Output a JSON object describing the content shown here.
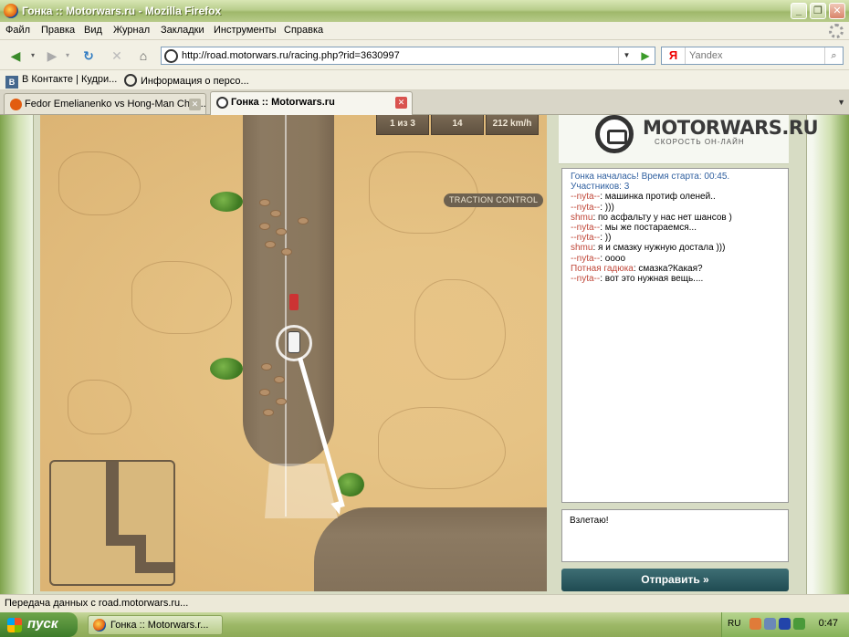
{
  "window": {
    "title": "Гонка :: Motorwars.ru - Mozilla Firefox"
  },
  "menu": [
    "Файл",
    "Правка",
    "Вид",
    "Журнал",
    "Закладки",
    "Инструменты",
    "Справка"
  ],
  "nav": {
    "url": "http://road.motorwars.ru/racing.php?rid=3630997",
    "search_placeholder": "Yandex",
    "search_engine_glyph": "Я"
  },
  "bookmarks": [
    "В Контакте | Кудри...",
    "Информация о персо..."
  ],
  "tabs": [
    {
      "label": "Fedor Emelianenko vs Hong-Man Choi ...",
      "active": false
    },
    {
      "label": "Гонка :: Motorwars.ru",
      "active": true
    }
  ],
  "game": {
    "hud": {
      "laps": "1 из 3",
      "position": "14",
      "speed": "212 km/h"
    },
    "traction": "TRACTION CONTROL"
  },
  "sidebar": {
    "logo_text": "MOTORWARS.RU",
    "logo_sub": "СКОРОСТЬ ОН-ЛАЙН",
    "chat": [
      {
        "type": "sys",
        "text": "Гонка началась! Время старта: 00:45."
      },
      {
        "type": "sys",
        "text": "Участников: 3"
      },
      {
        "type": "msg",
        "nick": "--nyta--",
        "nick_color": "red",
        "text": ": машинка  протиф оленей.."
      },
      {
        "type": "msg",
        "nick": "--nyta--",
        "nick_color": "red",
        "text": ": )))"
      },
      {
        "type": "msg",
        "nick": "shmu",
        "nick_color": "red",
        "text": ": по асфальту у нас нет шансов )"
      },
      {
        "type": "msg",
        "nick": "--nyta--",
        "nick_color": "red",
        "text": ": мы же  постараемся..."
      },
      {
        "type": "msg",
        "nick": "--nyta--",
        "nick_color": "red",
        "text": ": ))"
      },
      {
        "type": "msg",
        "nick": "shmu",
        "nick_color": "red",
        "text": ": я и смазку нужную достала )))"
      },
      {
        "type": "msg",
        "nick": "--nyta--",
        "nick_color": "red",
        "text": ": оооо"
      },
      {
        "type": "msg",
        "nick": "Потная гадюка",
        "nick_color": "red",
        "text": ": смазка?Какая?"
      },
      {
        "type": "msg",
        "nick": "--nyta--",
        "nick_color": "red",
        "text": ": вот  это нужная вещь...."
      }
    ],
    "input_value": "Взлетаю!",
    "send_label": "Отправить »"
  },
  "status": {
    "text": "Передача данных с road.motorwars.ru..."
  },
  "taskbar": {
    "start_label": "пуск",
    "task_label": "Гонка :: Motorwars.r...",
    "lang": "RU",
    "clock": "0:47"
  }
}
